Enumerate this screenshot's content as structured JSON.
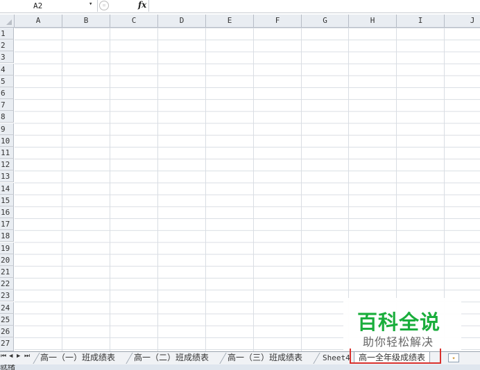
{
  "formula_bar": {
    "name_box": "A2",
    "name_dropdown_glyph": "▾",
    "cancel_glyph": "=",
    "fx_label": "fx",
    "formula_value": ""
  },
  "columns": [
    "A",
    "B",
    "C",
    "D",
    "E",
    "F",
    "G",
    "H",
    "I",
    "J"
  ],
  "rows": [
    "1",
    "2",
    "3",
    "4",
    "5",
    "6",
    "7",
    "8",
    "9",
    "10",
    "11",
    "12",
    "13",
    "14",
    "15",
    "16",
    "17",
    "18",
    "19",
    "20",
    "21",
    "22",
    "23",
    "24",
    "25",
    "26",
    "27"
  ],
  "tab_nav": [
    "⏮",
    "◀",
    "▶",
    "⏭"
  ],
  "sheet_tabs": [
    {
      "label": "高一（一）班成绩表",
      "active": false
    },
    {
      "label": "高一（二）班成绩表",
      "active": false
    },
    {
      "label": "高一（三）班成绩表",
      "active": false
    },
    {
      "label": "Sheet4",
      "active": false
    },
    {
      "label": "高一全年级成绩表",
      "active": true
    }
  ],
  "new_sheet_icon": "insert-worksheet-icon",
  "watermark": {
    "title": "百科全说",
    "subtitle": "助你轻松解决"
  },
  "status_bar": {
    "text": "就绪"
  },
  "colors": {
    "header_bg": "#e9edf2",
    "grid_line": "#d9dde3",
    "watermark_green": "#1aae3c",
    "highlight_red": "#d9302c"
  }
}
